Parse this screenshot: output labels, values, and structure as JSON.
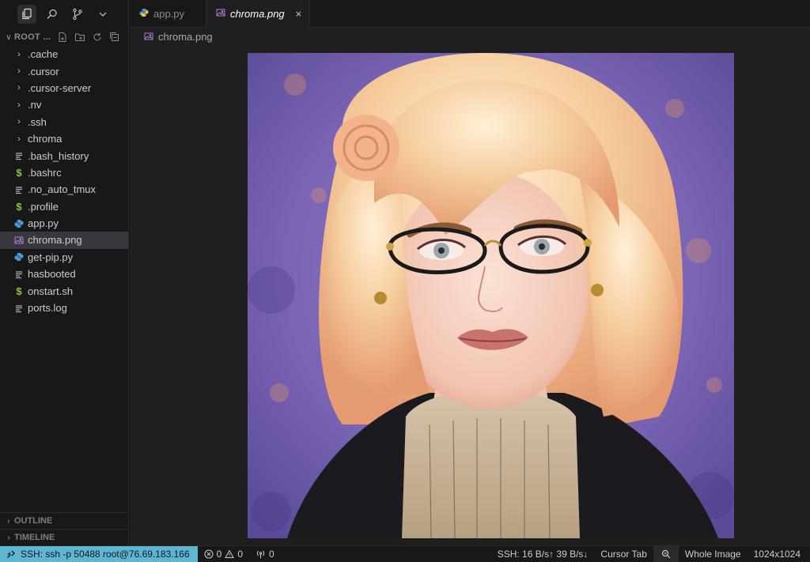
{
  "activity_bar": {
    "items": [
      {
        "name": "explorer-icon",
        "active": true
      },
      {
        "name": "search-icon",
        "active": false
      },
      {
        "name": "source-control-icon",
        "active": false
      },
      {
        "name": "chevron-down-icon",
        "active": false
      }
    ]
  },
  "explorer": {
    "title": "ROOT ...",
    "tools": [
      "new-file-icon",
      "new-folder-icon",
      "refresh-icon",
      "collapse-all-icon"
    ],
    "items": [
      {
        "label": ".cache",
        "kind": "folder"
      },
      {
        "label": ".cursor",
        "kind": "folder"
      },
      {
        "label": ".cursor-server",
        "kind": "folder"
      },
      {
        "label": ".nv",
        "kind": "folder"
      },
      {
        "label": ".ssh",
        "kind": "folder"
      },
      {
        "label": "chroma",
        "kind": "folder"
      },
      {
        "label": ".bash_history",
        "kind": "text"
      },
      {
        "label": ".bashrc",
        "kind": "shell"
      },
      {
        "label": ".no_auto_tmux",
        "kind": "text"
      },
      {
        "label": ".profile",
        "kind": "shell"
      },
      {
        "label": "app.py",
        "kind": "python"
      },
      {
        "label": "chroma.png",
        "kind": "image",
        "selected": true
      },
      {
        "label": "get-pip.py",
        "kind": "python"
      },
      {
        "label": "hasbooted",
        "kind": "text"
      },
      {
        "label": "onstart.sh",
        "kind": "shell"
      },
      {
        "label": "ports.log",
        "kind": "text"
      }
    ],
    "outline_label": "OUTLINE",
    "timeline_label": "TIMELINE"
  },
  "tabs": [
    {
      "label": "app.py",
      "icon": "python-icon",
      "active": false
    },
    {
      "label": "chroma.png",
      "icon": "image-icon",
      "active": true,
      "close": "×"
    }
  ],
  "breadcrumb": {
    "label": "chroma.png"
  },
  "statusbar": {
    "remote": "SSH: ssh -p 50488 root@76.69.183.166",
    "errors": "0",
    "warnings": "0",
    "ports": "0",
    "ssh_traffic": "SSH: 16 B/s↑ 39 B/s↓",
    "cursor_tab": "Cursor Tab",
    "zoom": "Whole Image",
    "dimensions": "1024x1024"
  },
  "colors": {
    "remote_bg": "#5fb6d1",
    "selected_bg": "#37373d",
    "python_blue": "#4e9bd6",
    "shell_green": "#8bc34a",
    "image_purple": "#b180d7"
  }
}
